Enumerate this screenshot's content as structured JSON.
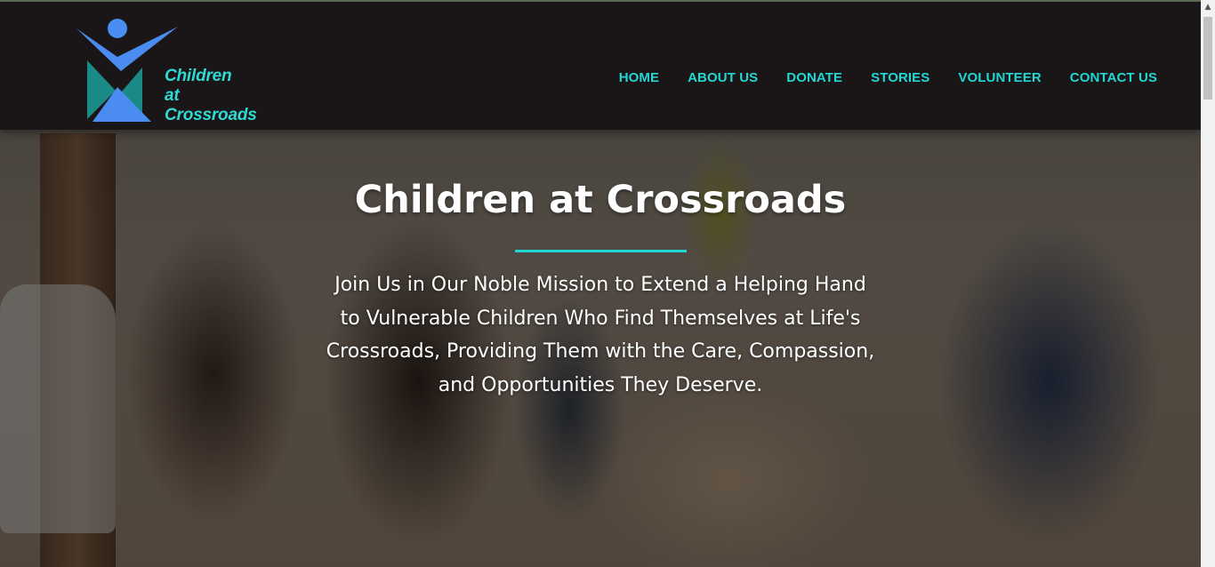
{
  "site": {
    "logo": {
      "line1": "Children",
      "line2": "at Crossroads"
    },
    "nav": {
      "items": [
        {
          "label": "HOME"
        },
        {
          "label": "ABOUT US"
        },
        {
          "label": "DONATE"
        },
        {
          "label": "STORIES"
        },
        {
          "label": "VOLUNTEER"
        },
        {
          "label": "CONTACT US"
        }
      ]
    }
  },
  "hero": {
    "title": "Children at Crossroads",
    "subtitle": "Join Us in Our Noble Mission to Extend a Helping Hand to Vulnerable Children Who Find Themselves at Life's Crossroads, Providing Them with the Care, Compassion, and Opportunities They Deserve."
  },
  "colors": {
    "accent": "#22d7d3",
    "header_bg": "#1a1617",
    "logo_blue": "#4a8cf0",
    "logo_teal": "#1a8a86"
  },
  "icons": {
    "scroll_up": "up-arrow-icon"
  }
}
